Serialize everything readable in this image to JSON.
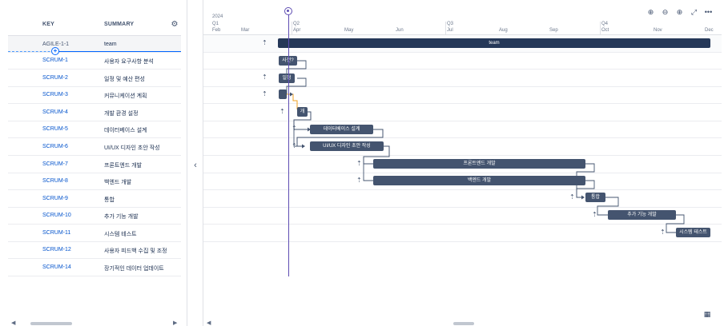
{
  "table": {
    "header_key": "KEY",
    "header_summary": "SUMMARY",
    "settings_icon": "gear-icon",
    "parent": {
      "key": "AGILE-1-1",
      "summary": "team"
    },
    "rows": [
      {
        "key": "SCRUM-1",
        "summary": "사용자 요구사항 분석"
      },
      {
        "key": "SCRUM-2",
        "summary": "일정 및 예산 편성"
      },
      {
        "key": "SCRUM-3",
        "summary": "커뮤니케이션 계획"
      },
      {
        "key": "SCRUM-4",
        "summary": "개발 환경 설정"
      },
      {
        "key": "SCRUM-5",
        "summary": "데이터베이스 설계"
      },
      {
        "key": "SCRUM-6",
        "summary": "UI/UX 디자인 초안 작성"
      },
      {
        "key": "SCRUM-7",
        "summary": "프론트엔드 개발"
      },
      {
        "key": "SCRUM-8",
        "summary": "백엔드 개발"
      },
      {
        "key": "SCRUM-9",
        "summary": "통합"
      },
      {
        "key": "SCRUM-10",
        "summary": "추가 기능 개발"
      },
      {
        "key": "SCRUM-11",
        "summary": "시스템 테스트"
      },
      {
        "key": "SCRUM-12",
        "summary": "사용자 피드백 수집 및 조정"
      },
      {
        "key": "SCRUM-14",
        "summary": "장기적인 데이터 업데이트"
      }
    ]
  },
  "timeline": {
    "year": "2024",
    "quarters": [
      "Q1",
      "Q2",
      "Q3",
      "Q4"
    ],
    "months": [
      "Feb",
      "Mar",
      "Apr",
      "May",
      "Jun",
      "Jul",
      "Aug",
      "Sep",
      "Oct",
      "Nov",
      "Dec"
    ],
    "bars": {
      "team": "team",
      "scrum1": "사전?",
      "scrum2": "일정",
      "scrum3": "",
      "scrum4": "개",
      "scrum5": "데이터베이스 설계",
      "scrum6": "UI/UX 디자인 초안 작성",
      "scrum7": "프론트엔드 개발",
      "scrum8": "백엔드 개발",
      "scrum9": "통합",
      "scrum10": "추가 기능 개발",
      "scrum11": "시스템 테스트"
    }
  },
  "toolbar": {
    "icons": [
      "today-icon",
      "zoom-out-icon",
      "zoom-in-icon",
      "expand-icon",
      "more-icon"
    ],
    "glyphs": [
      "⊕",
      "⊖",
      "⊕",
      "⤢",
      "•••"
    ]
  },
  "colors": {
    "bar": "#44546f",
    "today": "#5e4db2",
    "link": "#0052cc",
    "dependency": "#f0a020"
  }
}
